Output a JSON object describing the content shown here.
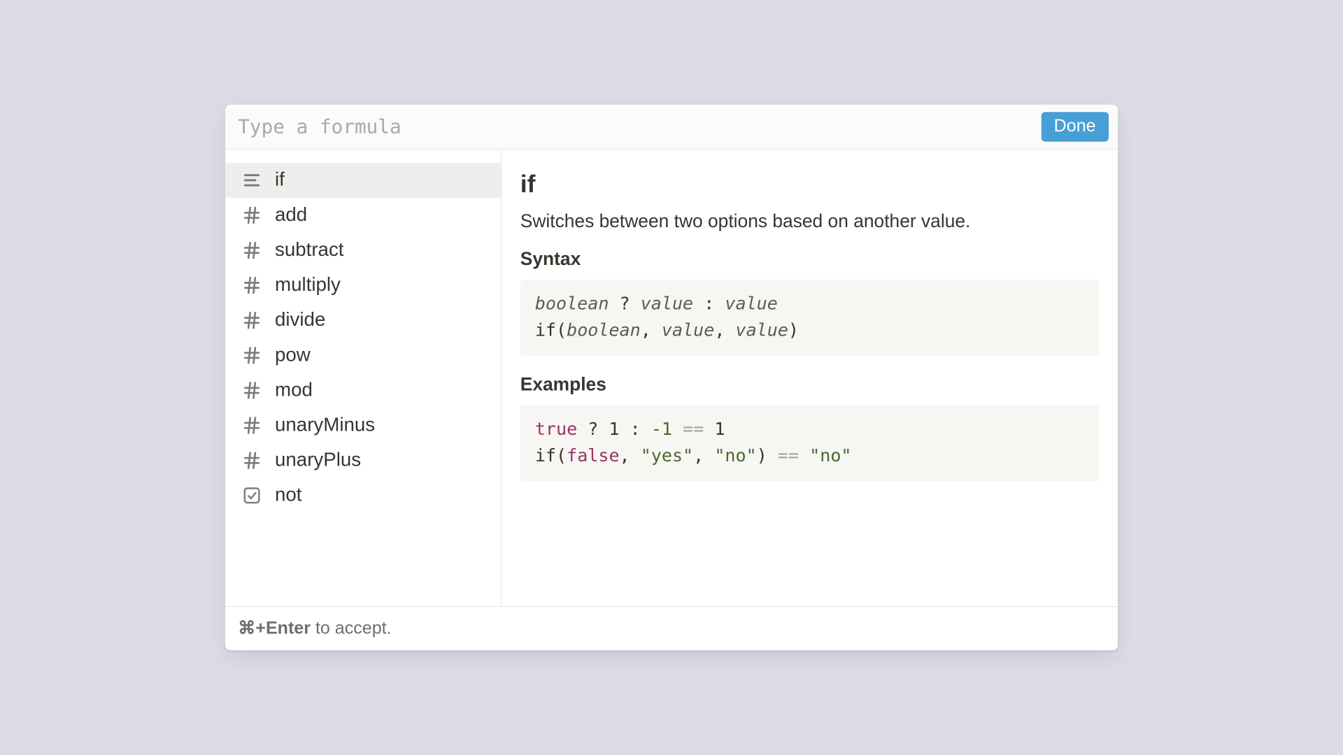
{
  "header": {
    "placeholder": "Type a formula",
    "done_label": "Done"
  },
  "sidebar": {
    "items": [
      {
        "label": "if",
        "icon": "text",
        "selected": true
      },
      {
        "label": "add",
        "icon": "hash",
        "selected": false
      },
      {
        "label": "subtract",
        "icon": "hash",
        "selected": false
      },
      {
        "label": "multiply",
        "icon": "hash",
        "selected": false
      },
      {
        "label": "divide",
        "icon": "hash",
        "selected": false
      },
      {
        "label": "pow",
        "icon": "hash",
        "selected": false
      },
      {
        "label": "mod",
        "icon": "hash",
        "selected": false
      },
      {
        "label": "unaryMinus",
        "icon": "hash",
        "selected": false
      },
      {
        "label": "unaryPlus",
        "icon": "hash",
        "selected": false
      },
      {
        "label": "not",
        "icon": "check",
        "selected": false
      }
    ]
  },
  "detail": {
    "title": "if",
    "description": "Switches between two options based on another value.",
    "syntax_label": "Syntax",
    "syntax_lines": [
      [
        {
          "t": "boolean",
          "k": "param"
        },
        {
          "t": " ? ",
          "k": "plain"
        },
        {
          "t": "value",
          "k": "param"
        },
        {
          "t": " : ",
          "k": "plain"
        },
        {
          "t": "value",
          "k": "param"
        }
      ],
      [
        {
          "t": "if(",
          "k": "plain"
        },
        {
          "t": "boolean",
          "k": "param"
        },
        {
          "t": ", ",
          "k": "plain"
        },
        {
          "t": "value",
          "k": "param"
        },
        {
          "t": ", ",
          "k": "plain"
        },
        {
          "t": "value",
          "k": "param"
        },
        {
          "t": ")",
          "k": "plain"
        }
      ]
    ],
    "examples_label": "Examples",
    "example_lines": [
      [
        {
          "t": "true",
          "k": "bool"
        },
        {
          "t": " ? ",
          "k": "plain"
        },
        {
          "t": "1",
          "k": "plain"
        },
        {
          "t": " : ",
          "k": "plain"
        },
        {
          "t": "-1",
          "k": "num"
        },
        {
          "t": " ",
          "k": "plain"
        },
        {
          "t": "==",
          "k": "op"
        },
        {
          "t": " ",
          "k": "plain"
        },
        {
          "t": "1",
          "k": "plain"
        }
      ],
      [
        {
          "t": "if(",
          "k": "plain"
        },
        {
          "t": "false",
          "k": "bool"
        },
        {
          "t": ", ",
          "k": "plain"
        },
        {
          "t": "\"yes\"",
          "k": "str"
        },
        {
          "t": ", ",
          "k": "plain"
        },
        {
          "t": "\"no\"",
          "k": "str"
        },
        {
          "t": ") ",
          "k": "plain"
        },
        {
          "t": "==",
          "k": "op"
        },
        {
          "t": " ",
          "k": "plain"
        },
        {
          "t": "\"no\"",
          "k": "str"
        }
      ]
    ]
  },
  "footer": {
    "shortcut": "⌘+Enter",
    "hint_rest": " to accept."
  },
  "icons": {
    "text": "text-icon",
    "hash": "hash-icon",
    "check": "checkbox-icon"
  }
}
